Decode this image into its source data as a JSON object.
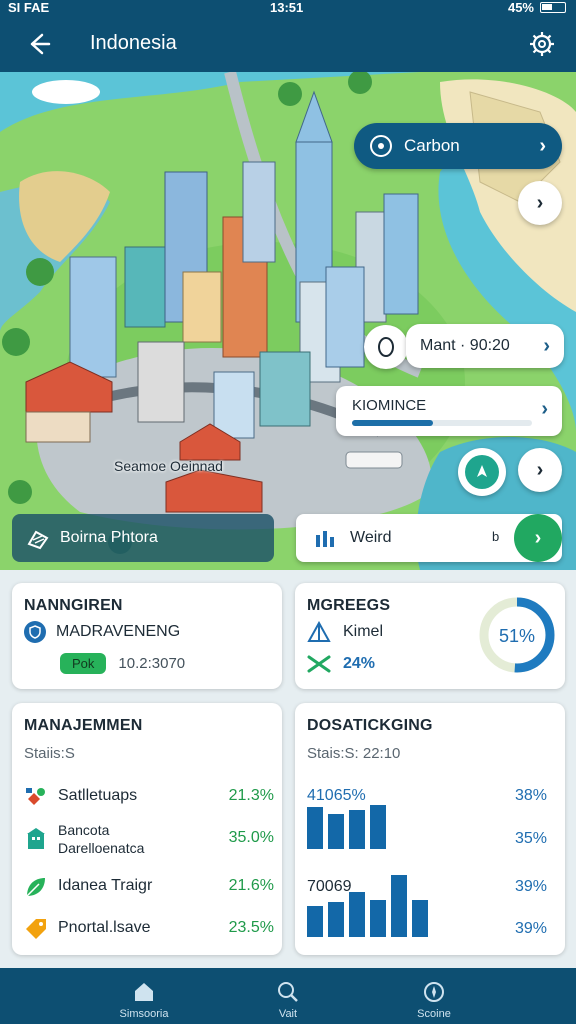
{
  "status_bar": {
    "left": "SI FAE",
    "time": "13:51",
    "battery": "45%"
  },
  "app_bar": {
    "title": "Indonesia",
    "back_icon": "back-arrow-icon",
    "settings_icon": "gear-icon"
  },
  "map": {
    "place_label": "Seamoe Oeinnad",
    "carbon": {
      "label": "Carbon",
      "icon": "location-pin-icon"
    },
    "mant": {
      "label": "Mant · 90:20"
    },
    "kiosk": {
      "label": "KIOMINCE",
      "progress_percent": 45
    },
    "photo_button": {
      "label": "Boirna Phtora"
    },
    "weird_card": {
      "label": "Weird",
      "tiny": "b"
    }
  },
  "cards": {
    "naming": {
      "title": "NANNGIREN",
      "item": "MADRAVENENG",
      "badge": "Pok",
      "value": "10.2:3070"
    },
    "progress": {
      "title": "MGREEGS",
      "item": "Kimel",
      "change": "24%",
      "ring_label": "51%",
      "ring_fraction": 0.51
    },
    "management": {
      "title": "MANAJEMMEN",
      "subtitle": "Staiis:S",
      "items": [
        {
          "name": "Satlletuaps",
          "pct": "21.3%"
        },
        {
          "name": "Bancota Darelloenatca",
          "pct": "35.0%"
        },
        {
          "name": "Idanea Traigr",
          "pct": "21.6%"
        },
        {
          "name": "Pnortal.lsave",
          "pct": "23.5%"
        }
      ]
    },
    "dispatching": {
      "title": "DOSATICKGING",
      "subtitle": "Stais:S: 22:10",
      "group1": {
        "value": "41065%",
        "pct_a": "38%",
        "pct_b": "35%",
        "bars": [
          36,
          30,
          34,
          38
        ]
      },
      "group2": {
        "value": "70069",
        "pct_a": "39%",
        "pct_b": "39%",
        "bars": [
          30,
          34,
          44,
          36,
          60,
          36
        ]
      }
    }
  },
  "bottom_nav": [
    {
      "label": "Simsooria",
      "icon": "home-icon"
    },
    {
      "label": "Vait",
      "icon": "search-icon"
    },
    {
      "label": "Scoine",
      "icon": "compass-icon"
    }
  ],
  "colors": {
    "primary": "#0d4f72",
    "accent_green": "#21a861",
    "accent_blue": "#1f6db0"
  }
}
